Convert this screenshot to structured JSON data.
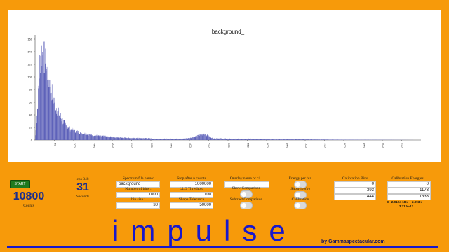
{
  "chart_data": {
    "type": "bar",
    "title": "background_",
    "xlabel": "",
    "ylabel": "",
    "ylim": [
      0,
      160
    ],
    "xlim": [
      0,
      1000
    ],
    "y_ticks": [
      0,
      20,
      40,
      60,
      80,
      100,
      120,
      140,
      160
    ],
    "x_ticks": [
      50,
      100,
      150,
      200,
      250,
      300,
      350,
      400,
      450,
      500,
      550,
      600,
      650,
      700,
      750,
      800,
      850,
      900,
      950
    ],
    "bar_color": "#5b5fb8",
    "profile": [
      [
        0,
        0
      ],
      [
        4,
        30
      ],
      [
        8,
        70
      ],
      [
        12,
        120
      ],
      [
        16,
        140
      ],
      [
        20,
        135
      ],
      [
        25,
        128
      ],
      [
        30,
        110
      ],
      [
        35,
        98
      ],
      [
        40,
        85
      ],
      [
        45,
        72
      ],
      [
        50,
        62
      ],
      [
        55,
        52
      ],
      [
        60,
        44
      ],
      [
        65,
        38
      ],
      [
        70,
        32
      ],
      [
        75,
        27
      ],
      [
        80,
        23
      ],
      [
        90,
        18
      ],
      [
        100,
        15
      ],
      [
        110,
        13
      ],
      [
        120,
        11
      ],
      [
        130,
        10
      ],
      [
        140,
        9
      ],
      [
        150,
        8
      ],
      [
        160,
        7
      ],
      [
        170,
        6
      ],
      [
        180,
        6
      ],
      [
        190,
        5
      ],
      [
        200,
        5
      ],
      [
        210,
        4
      ],
      [
        220,
        4
      ],
      [
        230,
        4
      ],
      [
        250,
        3
      ],
      [
        270,
        3
      ],
      [
        290,
        3
      ],
      [
        310,
        2
      ],
      [
        330,
        2
      ],
      [
        350,
        2
      ],
      [
        380,
        2
      ],
      [
        400,
        3
      ],
      [
        430,
        8
      ],
      [
        440,
        10
      ],
      [
        450,
        6
      ],
      [
        460,
        3
      ],
      [
        500,
        2
      ],
      [
        540,
        2
      ],
      [
        560,
        2
      ],
      [
        600,
        1
      ],
      [
        700,
        1
      ],
      [
        800,
        0.5
      ],
      [
        900,
        0.3
      ],
      [
        1000,
        0
      ]
    ]
  },
  "controls": {
    "start_label": "START",
    "counts": "10800",
    "counts_label": "Counts",
    "cps_label": "cps 348",
    "seconds": "31",
    "seconds_label": "Seconds",
    "spectrum_name_label": "Spectrum file name:",
    "spectrum_name_value": "background_",
    "bins_label": "Number of bins :",
    "bins_value": "1000",
    "bin_size_label": "bin size :",
    "bin_size_value": "30",
    "stop_after_label": "Stop after n counts",
    "stop_after_value": "1000000",
    "lld_label": "LLD Threshold",
    "lld_value": "100",
    "shape_tolerance_label": "Shape Tolerance",
    "shape_tolerance_value": "50000",
    "overlay_label": "Overlay name or c/...",
    "overlay_value": "",
    "show_comparison_label": "Show Comparison",
    "subtract_comparison_label": "Subtract Comparison",
    "energy_per_bin_label": "Energy per bin",
    "show_log_label": "Show log(y)",
    "calibration_label": "Calibration",
    "calibration_bins_label": "Calibration Bins",
    "calibration_bins": [
      "0",
      "393",
      "444"
    ],
    "calibration_energies_label": "Calibration Energies",
    "calibration_energies": [
      "0",
      "1173",
      "1333"
    ],
    "calibration_equation_line1": "E -2.912e-18 x  + 2.993 x +",
    "calibration_equation_line2": "3.712e-13"
  },
  "brand": {
    "title": "impulse",
    "byline": "by Gammaspectacular.com"
  }
}
